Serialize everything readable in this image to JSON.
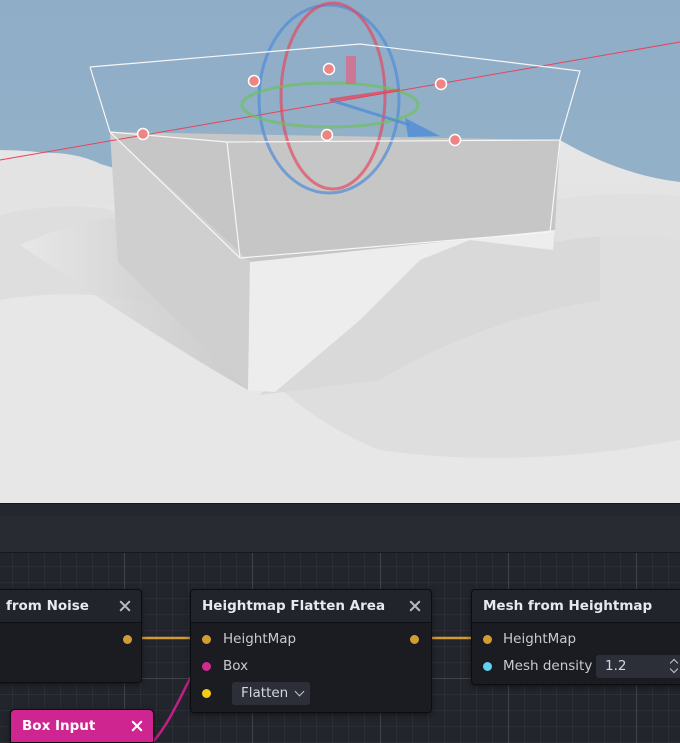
{
  "viewport": {
    "colors": {
      "sky": "#90aec7",
      "terrain": "#e2e2e2",
      "gizmo_x": "#e7435a",
      "gizmo_y": "#6cc15a",
      "gizmo_z": "#4e8cd8"
    }
  },
  "graph": {
    "nodes": {
      "from_noise": {
        "title": "from Noise",
        "close_icon": "close-icon"
      },
      "flatten_area": {
        "title": "Heightmap Flatten Area",
        "close_icon": "close-icon",
        "inputs": [
          "HeightMap",
          "Box"
        ],
        "mode_value": "Flatten"
      },
      "mesh_from_heightmap": {
        "title": "Mesh from Heightmap",
        "close_icon": "close-icon",
        "inputs": [
          "HeightMap",
          "Mesh density"
        ],
        "mesh_density_value": "1.2"
      },
      "box_input": {
        "title": "Box Input",
        "close_icon": "close-icon",
        "title_color": "#cf2590"
      }
    },
    "port_colors": {
      "heightmap": "#d29c35",
      "box": "#d22a93",
      "mode": "#f2cb1d",
      "number": "#5fd2ee"
    },
    "wire_colors": {
      "heightmap": "#d29c35",
      "box": "#c21f86"
    }
  }
}
